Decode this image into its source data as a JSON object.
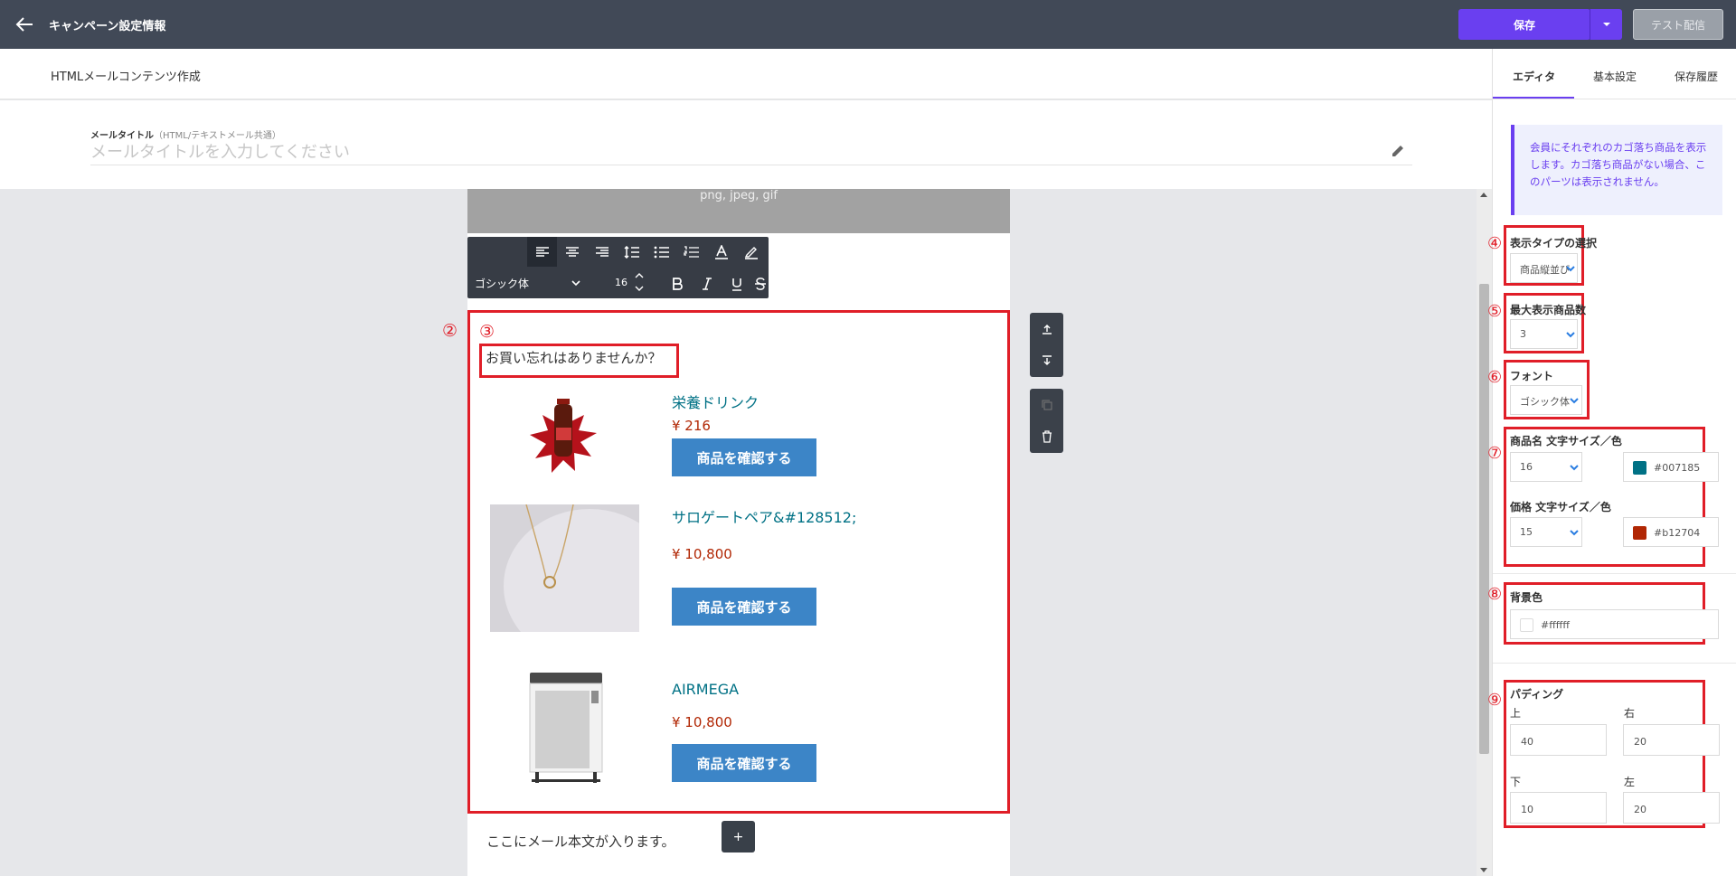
{
  "topbar": {
    "title": "キャンペーン設定情報",
    "save_label": "保存",
    "test_label": "テスト配信"
  },
  "subheader": {
    "title": "HTMLメールコンテンツ作成"
  },
  "mail_title": {
    "label": "メールタイトル",
    "label_sub": "（HTML/テキストメール共通）",
    "placeholder": "メールタイトルを入力してください"
  },
  "canvas": {
    "image_block_text": "png, jpeg, gif",
    "toolbar": {
      "font": "ゴシック体",
      "size": "16"
    },
    "block_title": "お買い忘れはありませんか？",
    "products": [
      {
        "name": "栄養ドリンク",
        "price": "¥ 216",
        "button": "商品を確認する"
      },
      {
        "name": "サロゲートペア&#128512;",
        "price": "¥ 10,800",
        "button": "商品を確認する"
      },
      {
        "name": "AIRMEGA",
        "price": "¥ 10,800",
        "button": "商品を確認する"
      }
    ],
    "body_text": "ここにメール本文が入ります。",
    "add_label": "+"
  },
  "annotations": {
    "n2": "②",
    "n3": "③",
    "n4": "④",
    "n5": "⑤",
    "n6": "⑥",
    "n7": "⑦",
    "n8": "⑧",
    "n9": "⑨"
  },
  "panel": {
    "tabs": [
      "エディタ",
      "基本設定",
      "保存履歴"
    ],
    "notice": "会員にそれぞれのカゴ落ち商品を表示します。カゴ落ち商品がない場合、このパーツは表示されません。",
    "display_type": {
      "label": "表示タイプの選択",
      "value": "商品縦並び"
    },
    "max_items": {
      "label": "最大表示商品数",
      "value": "3"
    },
    "font": {
      "label": "フォント",
      "value": "ゴシック体"
    },
    "name_style": {
      "label": "商品名 文字サイズ／色",
      "size": "16",
      "color": "#007185"
    },
    "price_style": {
      "label": "価格 文字サイズ／色",
      "size": "15",
      "color": "#b12704"
    },
    "background": {
      "label": "背景色",
      "color": "#ffffff"
    },
    "padding": {
      "label": "パディング",
      "top_label": "上",
      "top": "40",
      "right_label": "右",
      "right": "20",
      "bottom_label": "下",
      "bottom": "10",
      "left_label": "左",
      "left": "20"
    }
  },
  "colors": {
    "accent": "#6a3ff0",
    "annotation_red": "#e01e28",
    "product_button": "#3c85c7"
  }
}
